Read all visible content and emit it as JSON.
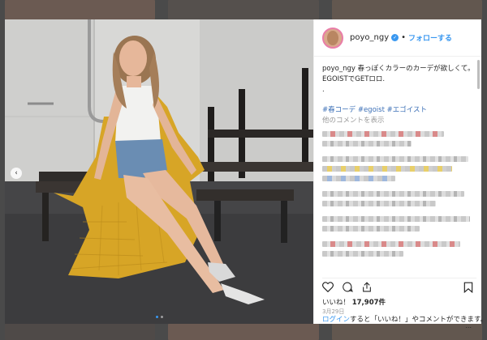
{
  "post": {
    "username": "poyo_ngy",
    "follow_label": "フォローする",
    "bullet": "•",
    "caption": "春っぽくカラーのカーデが欲しくて。",
    "caption_line2": "EGOISTでGETロロ.",
    "caption_line3": ".",
    "hashtags": [
      "#春コーデ",
      "#egoist",
      "#エゴイスト"
    ],
    "view_more_comments": "他のコメントを表示",
    "likes_label": "いいね！",
    "likes_count": "17,907件",
    "date": "3月29日",
    "login_link": "ログイン",
    "login_text": "すると「いいね！」やコメントができます。",
    "more": "..."
  },
  "icons": {
    "verified": "verified-badge-icon",
    "like": "heart-icon",
    "comment": "comment-bubble-icon",
    "share": "share-icon",
    "save": "bookmark-icon",
    "carousel_prev": "chevron-left-icon"
  },
  "colors": {
    "link_blue": "#3897f0",
    "hashtag_blue": "#3b6fb6",
    "muted": "#999999",
    "text": "#262626",
    "cardigan": "#d7a526"
  }
}
